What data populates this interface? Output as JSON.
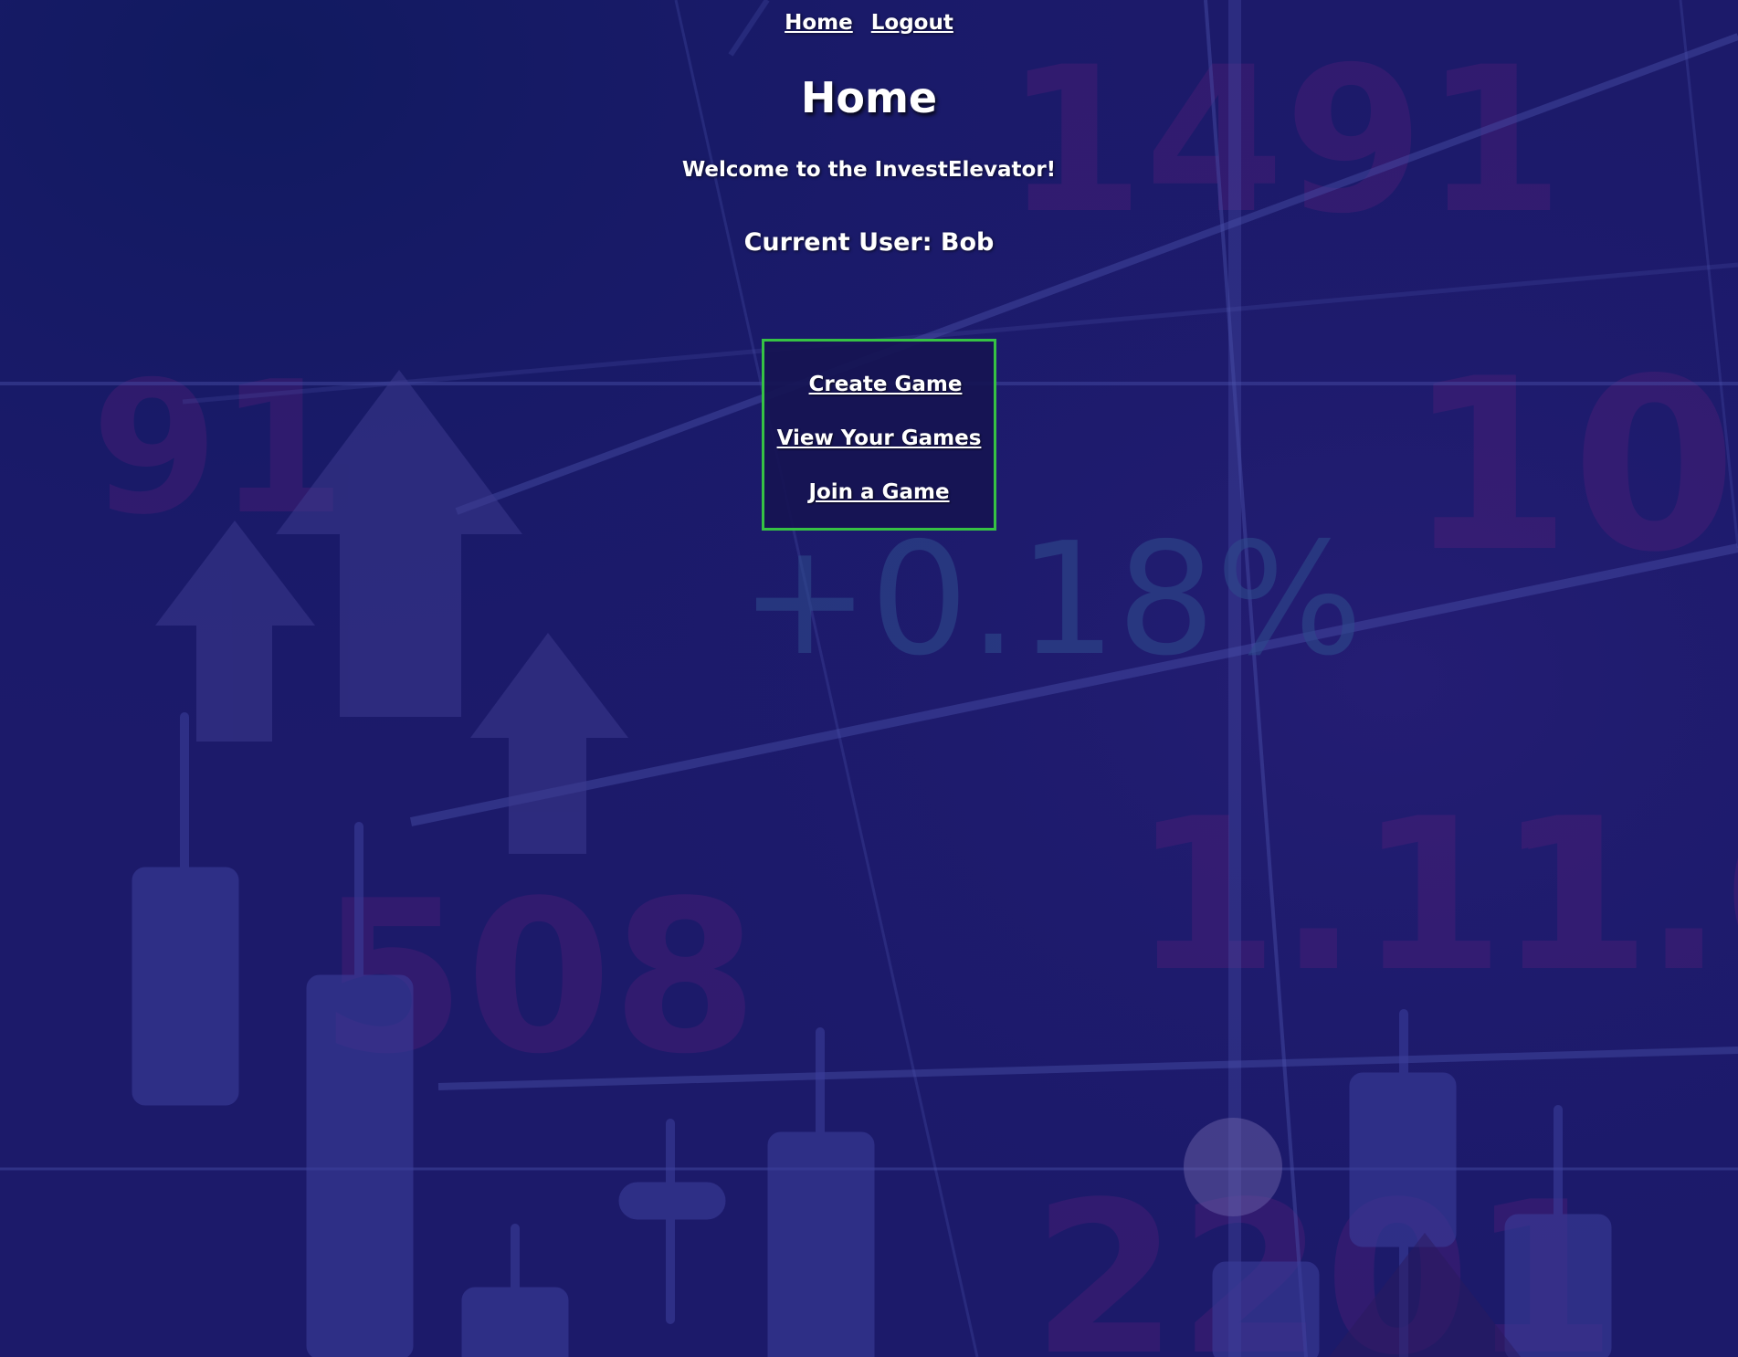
{
  "nav": {
    "home_label": "Home",
    "logout_label": "Logout"
  },
  "page": {
    "title": "Home",
    "welcome_text": "Welcome to the InvestElevator!",
    "current_user_text": "Current User: Bob"
  },
  "menu": {
    "create_game_label": "Create Game",
    "view_games_label": "View Your Games",
    "join_game_label": "Join a Game",
    "border_color": "#36c244"
  },
  "background": {
    "overlay_text": "+0.18%",
    "base_color": "#1b1b6e"
  }
}
